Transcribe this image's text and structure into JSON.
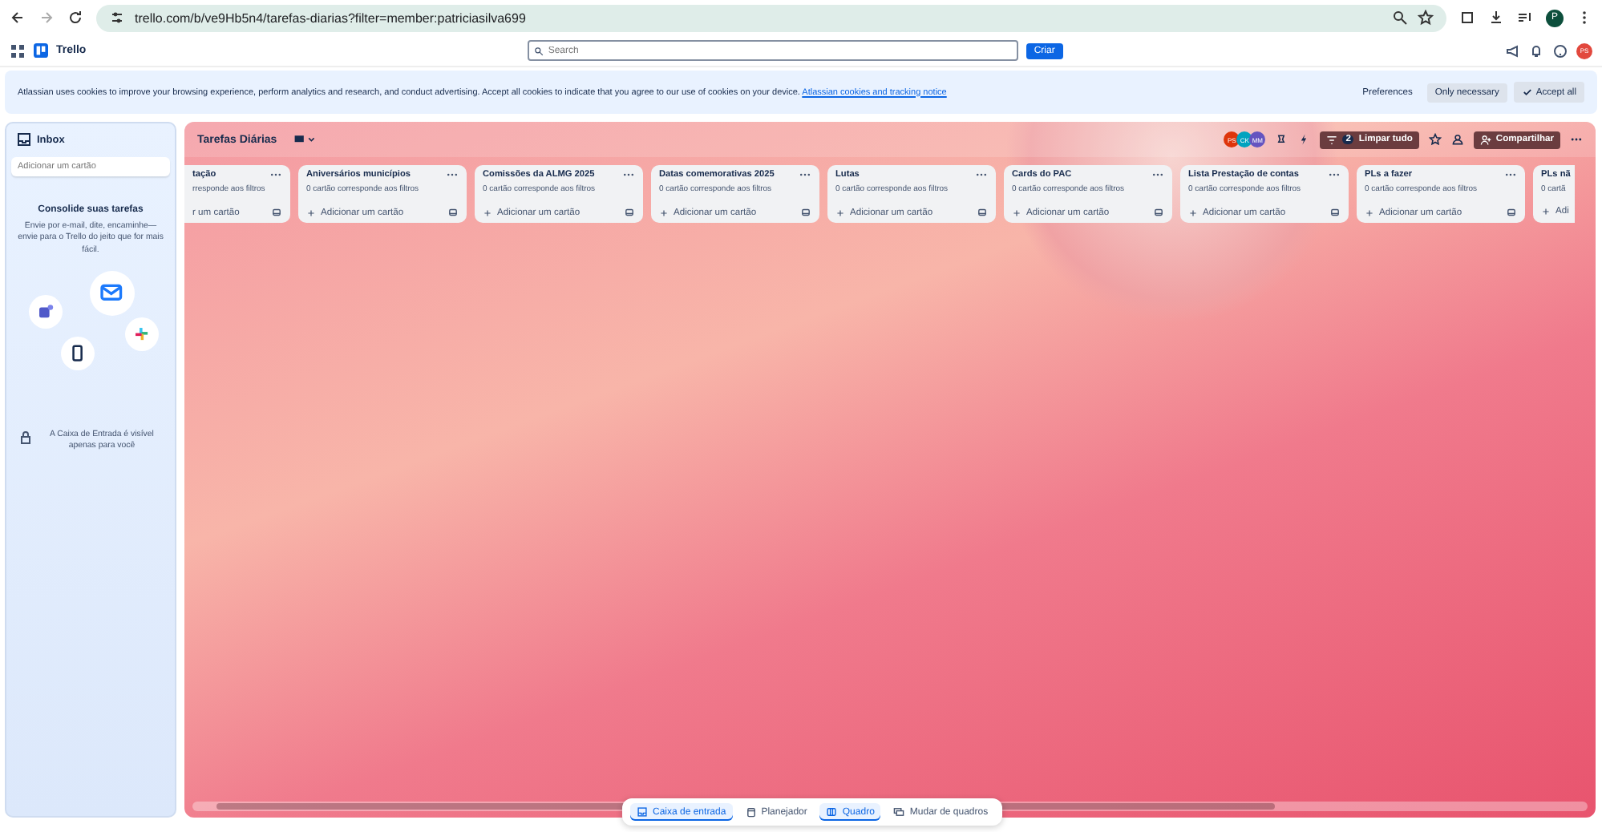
{
  "browser": {
    "url": "trello.com/b/ve9Hb5n4/tarefas-diarias?filter=member:patriciasilva699",
    "profile_initial": "P"
  },
  "header": {
    "app_name": "Trello",
    "search_placeholder": "Search",
    "create_label": "Criar",
    "user_initials": "PS"
  },
  "cookie_banner": {
    "text": "Atlassian uses cookies to improve your browsing experience, perform analytics and research, and conduct advertising. Accept all cookies to indicate that you agree to our use of cookies on your device.",
    "link": "Atlassian cookies and tracking notice",
    "buttons": [
      {
        "label": "Preferences",
        "kind": "plain"
      },
      {
        "label": "Only necessary",
        "kind": "secondary"
      },
      {
        "label": "Accept all",
        "kind": "accept"
      }
    ]
  },
  "inbox": {
    "title": "Inbox",
    "add_placeholder": "Adicionar um cartão",
    "promo_title": "Consolide suas tarefas",
    "promo_text": "Envie por e-mail, dite, encaminhe—envie para o Trello do jeito que for mais fácil.",
    "privacy_note": "A Caixa de Entrada é visível apenas para você"
  },
  "board": {
    "title": "Tarefas Diárias",
    "members": [
      {
        "initials": "PS",
        "color": "#de350b"
      },
      {
        "initials": "CK",
        "color": "#00a3bf"
      },
      {
        "initials": "MM",
        "color": "#6554c0"
      }
    ],
    "filter_count": "2",
    "clear_label": "Limpar tudo",
    "share_label": "Compartilhar",
    "lists": [
      {
        "title": "tação",
        "count": "rresponde aos filtros",
        "add": "r um cartão",
        "kind": "cut-left"
      },
      {
        "title": "Aniversários municípios",
        "count": "0 cartão corresponde aos filtros",
        "add": "Adicionar um cartão",
        "kind": "full"
      },
      {
        "title": "Comissões da ALMG 2025",
        "count": "0 cartão corresponde aos filtros",
        "add": "Adicionar um cartão",
        "kind": "full"
      },
      {
        "title": "Datas comemorativas 2025",
        "count": "0 cartão corresponde aos filtros",
        "add": "Adicionar um cartão",
        "kind": "full"
      },
      {
        "title": "Lutas",
        "count": "0 cartão corresponde aos filtros",
        "add": "Adicionar um cartão",
        "kind": "full"
      },
      {
        "title": "Cards do PAC",
        "count": "0 cartão corresponde aos filtros",
        "add": "Adicionar um cartão",
        "kind": "full"
      },
      {
        "title": "Lista Prestação de contas",
        "count": "0 cartão corresponde aos filtros",
        "add": "Adicionar um cartão",
        "kind": "full"
      },
      {
        "title": "PLs a fazer",
        "count": "0 cartão corresponde aos filtros",
        "add": "Adicionar um cartão",
        "kind": "full"
      },
      {
        "title": "PLs nã",
        "count": "0 cartã",
        "add": "Adi",
        "kind": "cut-right"
      }
    ]
  },
  "bottom_nav": [
    {
      "label": "Caixa de entrada",
      "selected": true
    },
    {
      "label": "Planejador",
      "selected": false
    },
    {
      "label": "Quadro",
      "selected": true
    },
    {
      "label": "Mudar de quadros",
      "selected": false
    }
  ]
}
